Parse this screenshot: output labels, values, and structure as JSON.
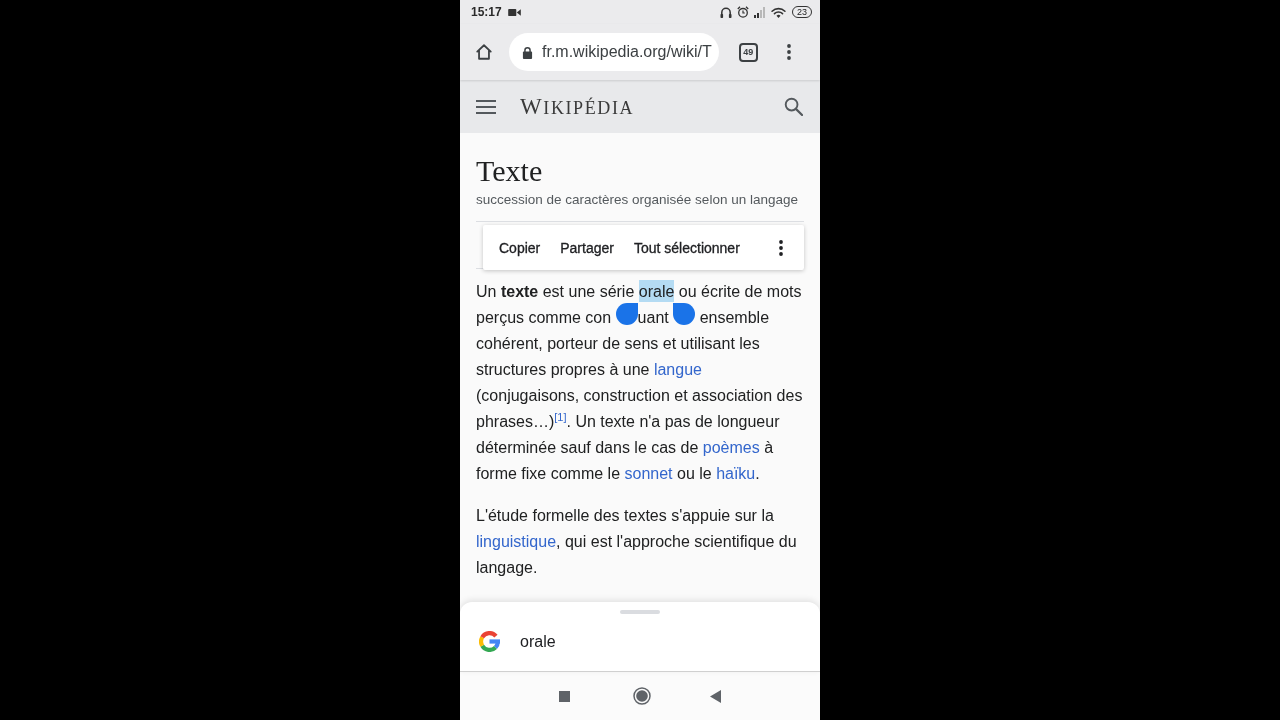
{
  "status_bar": {
    "time": "15:17",
    "battery": "23"
  },
  "browser": {
    "url": "fr.m.wikipedia.org/wiki/T",
    "tab_count": "49"
  },
  "site_header": {
    "logo": "WIKIPÉDIA"
  },
  "article": {
    "title": "Texte",
    "description": "succession de caractères organisée selon un langage",
    "paragraphs": [
      {
        "runs": [
          {
            "kind": "plain",
            "text": "Un "
          },
          {
            "kind": "bold",
            "text": "texte"
          },
          {
            "kind": "plain",
            "text": " est une série "
          },
          {
            "kind": "selection",
            "text": "orale"
          },
          {
            "kind": "plain",
            "text": " ou écrite de mots perçus comme con "
          },
          {
            "kind": "handle_start"
          },
          {
            "kind": "plain",
            "text": "uant "
          },
          {
            "kind": "handle_end"
          },
          {
            "kind": "plain",
            "text": " ensemble cohérent, porteur de sens et utilisant les structures propres à une "
          },
          {
            "kind": "link",
            "text": "langue"
          },
          {
            "kind": "plain",
            "text": " (conjugaisons, construction et association des phrases…)"
          },
          {
            "kind": "reference",
            "text": "[1]"
          },
          {
            "kind": "plain",
            "text": ". Un texte n'a pas de longueur déterminée sauf dans le cas de "
          },
          {
            "kind": "link",
            "text": "poèmes"
          },
          {
            "kind": "plain",
            "text": " à forme fixe comme le "
          },
          {
            "kind": "link",
            "text": "sonnet"
          },
          {
            "kind": "plain",
            "text": " ou le "
          },
          {
            "kind": "link",
            "text": "haïku"
          },
          {
            "kind": "plain",
            "text": "."
          }
        ]
      },
      {
        "runs": [
          {
            "kind": "plain",
            "text": "L'étude formelle des textes s'appuie sur la "
          },
          {
            "kind": "link",
            "text": "linguistique"
          },
          {
            "kind": "plain",
            "text": ", qui est l'approche scientifique du langage."
          }
        ]
      }
    ]
  },
  "selection_toolbar": {
    "actions": [
      "Copier",
      "Partager",
      "Tout sélectionner"
    ]
  },
  "search_sheet": {
    "query": "orale"
  }
}
